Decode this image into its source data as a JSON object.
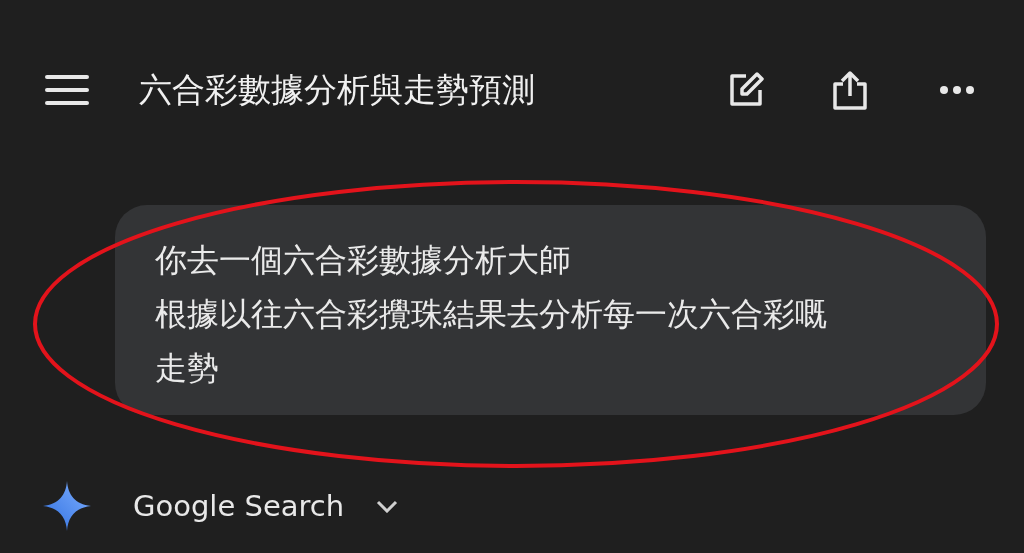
{
  "header": {
    "title": "六合彩數據分析與走勢預測"
  },
  "message": {
    "lines": [
      "你去一個六合彩數據分析大師",
      "根據以往六合彩攪珠結果去分析每一次六合彩嘅走勢"
    ]
  },
  "annotation": {
    "kind": "ellipse",
    "color": "#e3131b"
  },
  "tool": {
    "label": "Google Search",
    "expanded": false
  }
}
